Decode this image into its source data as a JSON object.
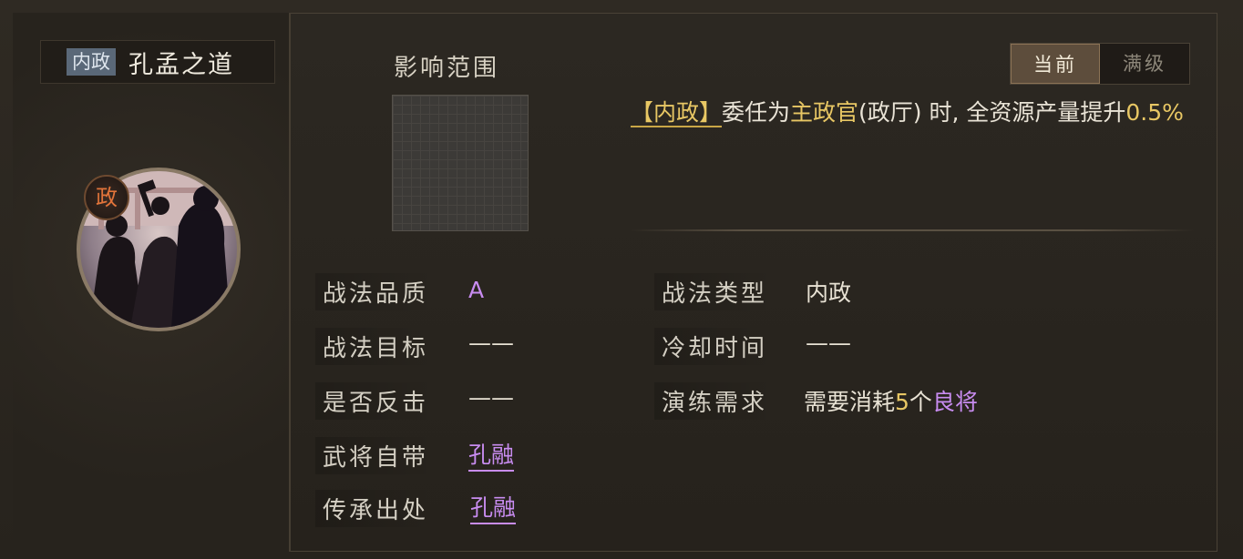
{
  "skill": {
    "category_tag": "内政",
    "name": "孔孟之道",
    "badge": "政"
  },
  "range": {
    "label": "影响范围"
  },
  "toggle": {
    "current_label": "当前",
    "max_label": "满级"
  },
  "description": {
    "tag": "【内政】",
    "part1": "委任为",
    "highlight_role": "主政官",
    "part2": "(政厅) 时, 全资源产量提升",
    "highlight_value": "0.5%"
  },
  "stats_left": [
    {
      "label": "战法品质",
      "value": "A"
    },
    {
      "label": "战法目标",
      "value": "——"
    },
    {
      "label": "是否反击",
      "value": "——"
    },
    {
      "label": "武将自带",
      "value": "孔融"
    },
    {
      "label": "传承出处",
      "value": "孔融"
    }
  ],
  "stats_right": [
    {
      "label": "战法类型",
      "value": "内政"
    },
    {
      "label": "冷却时间",
      "value": "——"
    },
    {
      "label": "演练需求",
      "value_prefix": "需要消耗",
      "value_number": "5",
      "value_unit": "个",
      "value_item": "良将"
    }
  ],
  "colors": {
    "accent_gold": "#e8c764",
    "accent_purple": "#c88cf0",
    "badge_orange": "#e2743a"
  }
}
